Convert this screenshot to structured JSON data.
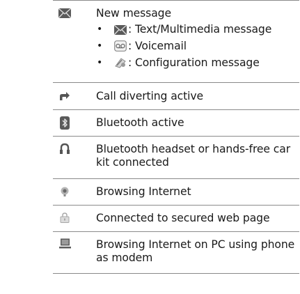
{
  "rows": [
    {
      "icon": "envelope-icon",
      "title": "New message",
      "bullets": [
        {
          "icon": "mini-envelope-icon",
          "label": ": Text/Multimedia message"
        },
        {
          "icon": "voicemail-icon",
          "label": ": Voicemail"
        },
        {
          "icon": "configuration-icon",
          "label": ": Configuration message"
        }
      ]
    },
    {
      "icon": "call-divert-icon",
      "title": "Call diverting active"
    },
    {
      "icon": "bluetooth-icon",
      "title": "Bluetooth active"
    },
    {
      "icon": "headset-icon",
      "title": "Bluetooth headset or hands-free car kit connected"
    },
    {
      "icon": "globe-icon",
      "title": "Browsing Internet"
    },
    {
      "icon": "lock-icon",
      "title": "Connected to secured web page"
    },
    {
      "icon": "pc-icon",
      "title": "Browsing Internet on PC using phone as modem"
    }
  ],
  "colors": {
    "icon_dark": "#555555",
    "icon_mid": "#8a8a8a",
    "icon_light": "#b9b9b9",
    "rule": "#8a8a8a"
  }
}
